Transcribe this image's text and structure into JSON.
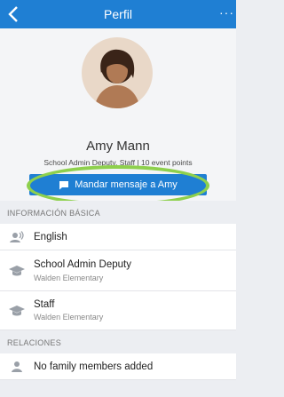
{
  "nav": {
    "title": "Perfil",
    "back_icon": "chevron-left-icon",
    "more_icon": "more-horizontal-icon",
    "more_glyph": "···"
  },
  "profile": {
    "name": "Amy Mann",
    "subtitle": "School Admin Deputy, Staff | 10 event points",
    "message_button": "Mandar mensaje a Amy",
    "message_icon": "chat-bubble-icon"
  },
  "sections": {
    "basic_info": "INFORMACIÓN BÁSICA",
    "relations": "RELACIONES"
  },
  "basic_info_items": [
    {
      "icon": "language-audio-icon",
      "primary": "English"
    },
    {
      "icon": "graduation-cap-icon",
      "primary": "School Admin Deputy",
      "secondary": "Walden Elementary"
    },
    {
      "icon": "graduation-cap-icon",
      "primary": "Staff",
      "secondary": "Walden Elementary"
    }
  ],
  "relations_items": [
    {
      "icon": "person-icon",
      "primary": "No family members added"
    }
  ],
  "colors": {
    "primary": "#1f7fd3",
    "highlight": "#8ed04d",
    "background": "#eceef2"
  }
}
